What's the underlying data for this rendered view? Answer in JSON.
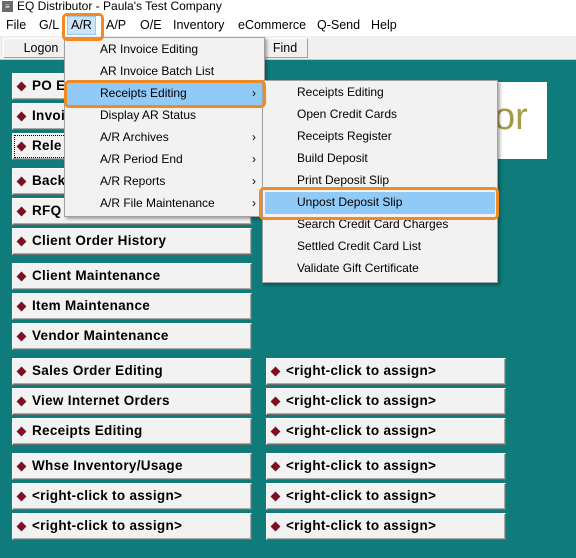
{
  "window": {
    "title": "EQ Distributor - Paula's Test Company",
    "icon": "eq-app-icon"
  },
  "menubar": [
    "File",
    "G/L",
    "A/R",
    "A/P",
    "O/E",
    "Inventory",
    "eCommerce",
    "Q-Send",
    "Help"
  ],
  "toolbar": {
    "logon": "Logon",
    "find": "Find"
  },
  "ar_menu": [
    {
      "label": "AR Invoice Editing",
      "submenu": false
    },
    {
      "label": "AR Invoice Batch List",
      "submenu": false
    },
    {
      "label": "Receipts Editing",
      "submenu": true
    },
    {
      "label": "Display AR Status",
      "submenu": false
    },
    {
      "label": "A/R Archives",
      "submenu": true
    },
    {
      "label": "A/R Period End",
      "submenu": true
    },
    {
      "label": "A/R Reports",
      "submenu": true
    },
    {
      "label": "A/R File Maintenance",
      "submenu": true
    }
  ],
  "receipts_submenu": [
    "Receipts Editing",
    "Open Credit Cards",
    "Receipts Register",
    "Build Deposit",
    "Print Deposit Slip",
    "Unpost Deposit Slip",
    "Search Credit Card Charges",
    "Settled Credit Card List",
    "Validate Gift Certificate"
  ],
  "left_buttons": [
    "PO E",
    "Invoi",
    "Rele",
    "Back",
    "RFQ",
    "Client Order History",
    "Client Maintenance",
    "Item Maintenance",
    "Vendor Maintenance",
    "Sales Order Editing",
    "View Internet Orders",
    "Receipts Editing",
    "Whse Inventory/Usage",
    "<right-click to assign>",
    "<right-click to assign>"
  ],
  "right_buttons": [
    "<right-click to assign>",
    "<right-click to assign>",
    "<right-click to assign>",
    "<right-click to assign>",
    "<right-click to assign>",
    "<right-click to assign>"
  ],
  "logo_fragment": "or",
  "colors": {
    "background": "#0f7b7b",
    "highlight": "#f08a24",
    "menu_hover": "#91c9f7",
    "bullet": "#7a1020"
  }
}
